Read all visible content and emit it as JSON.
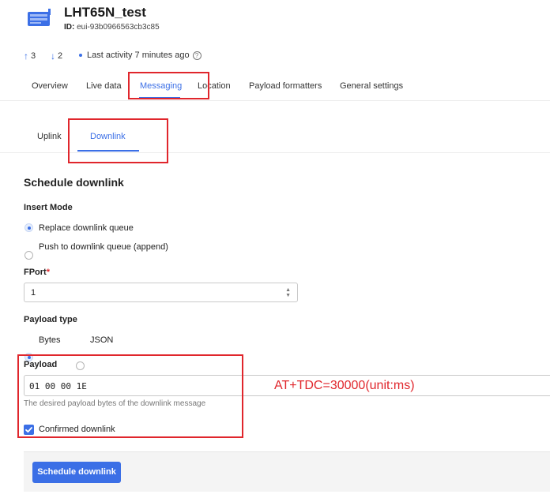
{
  "device": {
    "name": "LHT65N_test",
    "id_label": "ID:",
    "id_value": "eui-93b0966563cb3c85",
    "up_count": "3",
    "down_count": "2",
    "last_activity": "Last activity 7 minutes ago",
    "help": "?"
  },
  "tabs": [
    {
      "label": "Overview"
    },
    {
      "label": "Live data"
    },
    {
      "label": "Messaging"
    },
    {
      "label": "Location"
    },
    {
      "label": "Payload formatters"
    },
    {
      "label": "General settings"
    }
  ],
  "active_tab": "Messaging",
  "subtabs": [
    {
      "label": "Uplink"
    },
    {
      "label": "Downlink"
    }
  ],
  "active_subtab": "Downlink",
  "form": {
    "section_title": "Schedule downlink",
    "insert_mode_label": "Insert Mode",
    "insert_modes": [
      {
        "label": "Replace downlink queue",
        "selected": true
      },
      {
        "label": "Push to downlink queue (append)",
        "selected": false
      }
    ],
    "fport_label": "FPort",
    "fport_required": "*",
    "fport_value": "1",
    "payload_type_label": "Payload type",
    "payload_types": [
      {
        "label": "Bytes",
        "selected": true
      },
      {
        "label": "JSON",
        "selected": false
      }
    ],
    "payload_label": "Payload",
    "payload_value": "01 00 00 1E",
    "payload_hint": "The desired payload bytes of the downlink message",
    "confirmed_label": "Confirmed downlink",
    "confirmed_checked": true,
    "submit_label": "Schedule downlink"
  },
  "annotation": "AT+TDC=30000(unit:ms)",
  "colors": {
    "accent": "#3b6fe6",
    "annotation_red": "#e0262c"
  },
  "icons": {
    "device": "device-icon",
    "uplink": "arrow-up-icon",
    "downlink": "arrow-down-icon",
    "help": "help-circle-icon",
    "check": "checkmark-icon"
  }
}
